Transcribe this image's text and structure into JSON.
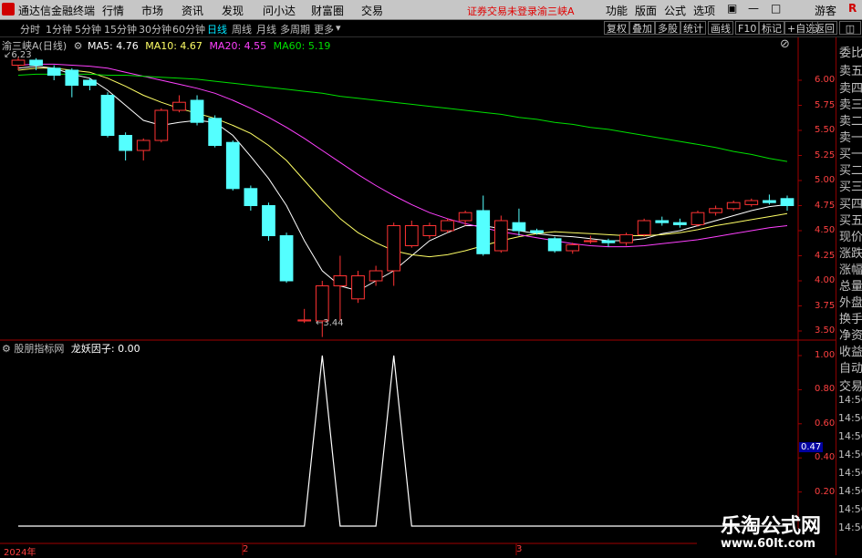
{
  "menubar": {
    "app_title": "通达信金融终端",
    "items": [
      "行情",
      "市场",
      "资讯",
      "发现",
      "问小达",
      "财富圈",
      "交易"
    ],
    "notice": "证券交易未登录",
    "stock": "渝三峡A",
    "right_items": [
      "功能",
      "版面",
      "公式",
      "选项"
    ],
    "guest": "游客"
  },
  "periods": {
    "items": [
      "分时",
      "1分钟",
      "5分钟",
      "15分钟",
      "30分钟",
      "60分钟",
      "日线",
      "周线",
      "月线",
      "多周期",
      "更多"
    ],
    "active": "日线",
    "tools": [
      "复权",
      "叠加",
      "多股",
      "统计",
      "画线",
      "F10",
      "标记",
      "+自选",
      "返回"
    ]
  },
  "main_chart": {
    "stock_label": "渝三峡A",
    "period_label": "(日线)",
    "ma5": "MA5: 4.76",
    "ma10": "MA10: 4.67",
    "ma20": "MA20: 4.55",
    "ma60": "MA60: 5.19",
    "high_marker": "6.23",
    "low_marker": "3.44",
    "y_ticks": [
      "6.00",
      "5.75",
      "5.50",
      "5.25",
      "5.00",
      "4.75",
      "4.50",
      "4.25",
      "4.00",
      "3.75",
      "3.50"
    ]
  },
  "indicator": {
    "name": "股朋指标网",
    "factor": "龙妖因子: 0.00",
    "y_ticks": [
      "1.00",
      "0.80",
      "0.60",
      "0.40",
      "0.20"
    ],
    "current": "0.47",
    "x_labels": [
      "2024年",
      "2",
      "3"
    ]
  },
  "right_panel": {
    "items": [
      "委比",
      "卖五",
      "卖四",
      "卖三",
      "卖二",
      "卖一",
      "买一",
      "买二",
      "买三",
      "买四",
      "买五",
      "现价",
      "涨跌",
      "涨幅",
      "总量",
      "外盘",
      "换手",
      "净资",
      "收益",
      "自动",
      "交易"
    ],
    "times": [
      "14:56",
      "14:56",
      "14:56",
      "14:56",
      "14:56",
      "14:56",
      "14:56",
      "14:56"
    ]
  },
  "watermark": {
    "cn": "乐淘公式网",
    "url": "www.60lt.com"
  },
  "chart_data": [
    {
      "type": "candlestick",
      "title": "渝三峡A (日线)",
      "up_color": "#ff3333",
      "down_color": "#54ffff",
      "candles": [
        {
          "o": 6.15,
          "c": 6.2,
          "h": 6.23,
          "l": 6.1
        },
        {
          "o": 6.2,
          "c": 6.15,
          "h": 6.22,
          "l": 6.1
        },
        {
          "o": 6.12,
          "c": 6.05,
          "h": 6.15,
          "l": 6.0
        },
        {
          "o": 6.1,
          "c": 5.95,
          "h": 6.12,
          "l": 5.83
        },
        {
          "o": 6.0,
          "c": 5.95,
          "h": 6.02,
          "l": 5.9
        },
        {
          "o": 5.85,
          "c": 5.45,
          "h": 5.88,
          "l": 5.43
        },
        {
          "o": 5.45,
          "c": 5.3,
          "h": 5.48,
          "l": 5.2
        },
        {
          "o": 5.3,
          "c": 5.4,
          "h": 5.42,
          "l": 5.2
        },
        {
          "o": 5.4,
          "c": 5.7,
          "h": 5.72,
          "l": 5.38
        },
        {
          "o": 5.7,
          "c": 5.78,
          "h": 5.85,
          "l": 5.68
        },
        {
          "o": 5.8,
          "c": 5.58,
          "h": 5.85,
          "l": 5.55
        },
        {
          "o": 5.62,
          "c": 5.35,
          "h": 5.65,
          "l": 5.33
        },
        {
          "o": 5.38,
          "c": 4.92,
          "h": 5.4,
          "l": 4.9
        },
        {
          "o": 4.92,
          "c": 4.75,
          "h": 4.95,
          "l": 4.7
        },
        {
          "o": 4.75,
          "c": 4.45,
          "h": 4.78,
          "l": 4.4
        },
        {
          "o": 4.45,
          "c": 4.0,
          "h": 4.48,
          "l": 3.98
        },
        {
          "o": 3.6,
          "c": 3.61,
          "h": 3.72,
          "l": 3.58
        },
        {
          "o": 3.6,
          "c": 3.95,
          "h": 4.0,
          "l": 3.44
        },
        {
          "o": 3.95,
          "c": 4.05,
          "h": 4.25,
          "l": 3.6
        },
        {
          "o": 3.82,
          "c": 4.05,
          "h": 4.1,
          "l": 3.78
        },
        {
          "o": 4.0,
          "c": 4.1,
          "h": 4.15,
          "l": 3.95
        },
        {
          "o": 4.1,
          "c": 4.55,
          "h": 4.58,
          "l": 3.95
        },
        {
          "o": 4.35,
          "c": 4.55,
          "h": 4.6,
          "l": 4.33
        },
        {
          "o": 4.45,
          "c": 4.55,
          "h": 4.58,
          "l": 4.42
        },
        {
          "o": 4.5,
          "c": 4.6,
          "h": 4.62,
          "l": 4.48
        },
        {
          "o": 4.6,
          "c": 4.68,
          "h": 4.7,
          "l": 4.55
        },
        {
          "o": 4.7,
          "c": 4.27,
          "h": 4.85,
          "l": 4.25
        },
        {
          "o": 4.3,
          "c": 4.6,
          "h": 4.65,
          "l": 4.28
        },
        {
          "o": 4.58,
          "c": 4.5,
          "h": 4.72,
          "l": 4.45
        },
        {
          "o": 4.5,
          "c": 4.48,
          "h": 4.52,
          "l": 4.46
        },
        {
          "o": 4.42,
          "c": 4.3,
          "h": 4.44,
          "l": 4.28
        },
        {
          "o": 4.3,
          "c": 4.36,
          "h": 4.38,
          "l": 4.27
        },
        {
          "o": 4.4,
          "c": 4.4,
          "h": 4.45,
          "l": 4.37
        },
        {
          "o": 4.4,
          "c": 4.38,
          "h": 4.42,
          "l": 4.34
        },
        {
          "o": 4.38,
          "c": 4.46,
          "h": 4.48,
          "l": 4.35
        },
        {
          "o": 4.46,
          "c": 4.6,
          "h": 4.62,
          "l": 4.44
        },
        {
          "o": 4.6,
          "c": 4.58,
          "h": 4.64,
          "l": 4.55
        },
        {
          "o": 4.58,
          "c": 4.56,
          "h": 4.62,
          "l": 4.53
        },
        {
          "o": 4.56,
          "c": 4.68,
          "h": 4.7,
          "l": 4.54
        },
        {
          "o": 4.68,
          "c": 4.72,
          "h": 4.75,
          "l": 4.65
        },
        {
          "o": 4.72,
          "c": 4.78,
          "h": 4.8,
          "l": 4.7
        },
        {
          "o": 4.76,
          "c": 4.8,
          "h": 4.82,
          "l": 4.74
        },
        {
          "o": 4.8,
          "c": 4.78,
          "h": 4.86,
          "l": 4.76
        },
        {
          "o": 4.82,
          "c": 4.75,
          "h": 4.85,
          "l": 4.7
        }
      ],
      "ma_lines": {
        "MA5": {
          "color": "#ffffff",
          "values": [
            6.12,
            6.14,
            6.12,
            6.06,
            6.02,
            5.9,
            5.75,
            5.6,
            5.55,
            5.58,
            5.6,
            5.58,
            5.45,
            5.24,
            5.02,
            4.75,
            4.4,
            4.1,
            3.95,
            3.9,
            4.0,
            4.1,
            4.25,
            4.4,
            4.48,
            4.55,
            4.55,
            4.52,
            4.5,
            4.47,
            4.45,
            4.44,
            4.42,
            4.4,
            4.4,
            4.42,
            4.47,
            4.5,
            4.55,
            4.6,
            4.65,
            4.7,
            4.74,
            4.76
          ]
        },
        "MA10": {
          "color": "#ffff66",
          "values": [
            6.1,
            6.12,
            6.12,
            6.1,
            6.08,
            6.02,
            5.94,
            5.85,
            5.78,
            5.72,
            5.67,
            5.62,
            5.55,
            5.47,
            5.35,
            5.2,
            5.0,
            4.8,
            4.62,
            4.48,
            4.38,
            4.3,
            4.26,
            4.24,
            4.26,
            4.3,
            4.35,
            4.4,
            4.44,
            4.47,
            4.49,
            4.48,
            4.47,
            4.46,
            4.45,
            4.45,
            4.46,
            4.48,
            4.51,
            4.55,
            4.58,
            4.61,
            4.64,
            4.67
          ]
        },
        "MA20": {
          "color": "#ff40ff",
          "values": [
            6.15,
            6.16,
            6.16,
            6.15,
            6.14,
            6.12,
            6.08,
            6.04,
            6.0,
            5.96,
            5.92,
            5.87,
            5.8,
            5.72,
            5.63,
            5.53,
            5.42,
            5.3,
            5.18,
            5.06,
            4.95,
            4.85,
            4.76,
            4.68,
            4.62,
            4.57,
            4.53,
            4.49,
            4.46,
            4.43,
            4.4,
            4.37,
            4.35,
            4.34,
            4.34,
            4.35,
            4.37,
            4.39,
            4.41,
            4.44,
            4.47,
            4.5,
            4.53,
            4.55
          ]
        },
        "MA60": {
          "color": "#00e000",
          "values": [
            6.05,
            6.06,
            6.06,
            6.06,
            6.06,
            6.05,
            6.05,
            6.04,
            6.03,
            6.02,
            6.01,
            5.99,
            5.97,
            5.95,
            5.93,
            5.91,
            5.89,
            5.87,
            5.84,
            5.82,
            5.8,
            5.78,
            5.76,
            5.74,
            5.72,
            5.7,
            5.68,
            5.66,
            5.63,
            5.61,
            5.58,
            5.56,
            5.53,
            5.51,
            5.48,
            5.45,
            5.42,
            5.39,
            5.36,
            5.33,
            5.29,
            5.26,
            5.22,
            5.19
          ]
        }
      },
      "ylim": [
        3.4,
        6.3
      ]
    },
    {
      "type": "line",
      "title": "龙妖因子",
      "series": [
        {
          "name": "龙妖因子",
          "color": "#ffffff",
          "values": [
            0,
            0,
            0,
            0,
            0,
            0,
            0,
            0,
            0,
            0,
            0,
            0,
            0,
            0,
            0,
            0,
            0,
            1,
            0,
            0,
            0,
            1,
            0,
            0,
            0,
            0,
            0,
            0,
            0,
            0,
            0,
            0,
            0,
            0,
            0,
            0,
            0,
            0,
            0,
            0,
            0,
            0,
            0,
            0
          ]
        }
      ],
      "ylim": [
        0,
        1.1
      ]
    }
  ]
}
